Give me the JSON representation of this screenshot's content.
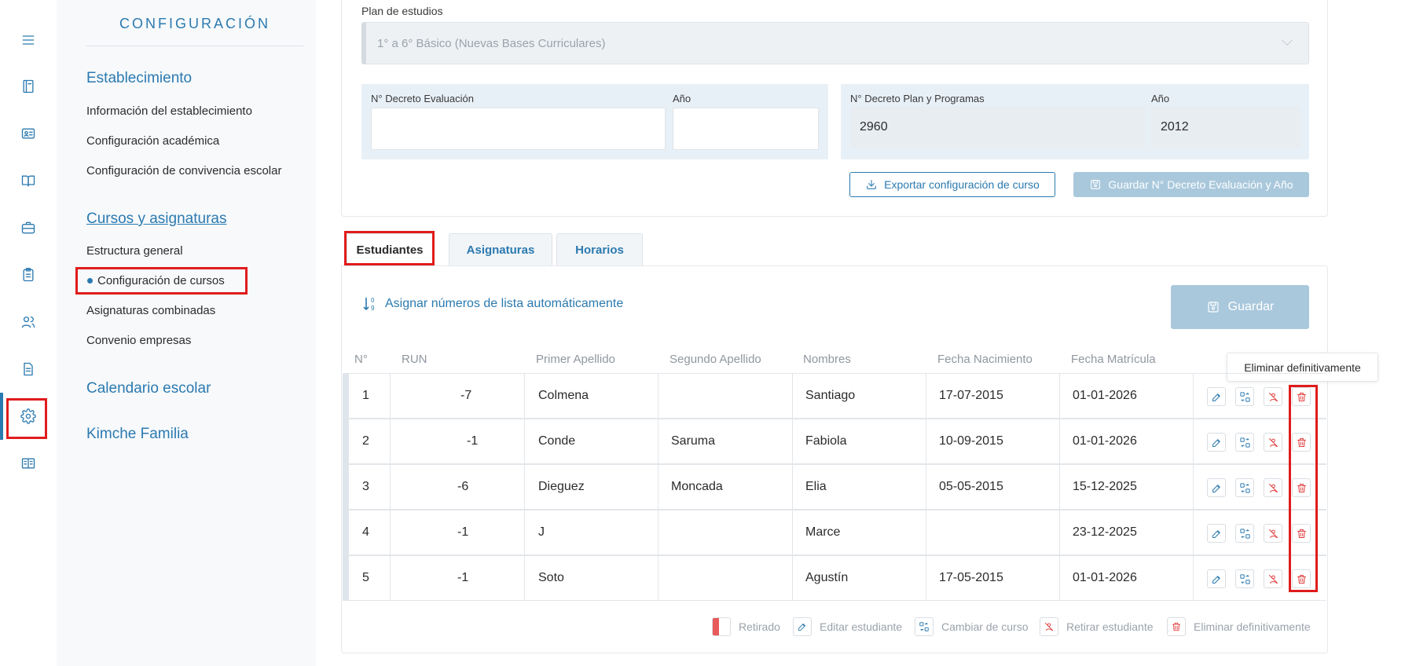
{
  "rail": {
    "icons": [
      "menu-icon",
      "book-icon",
      "id-card-icon",
      "open-book-icon",
      "briefcase-icon",
      "clipboard-icon",
      "users-icon",
      "document-icon",
      "gear-icon",
      "notebook-icon"
    ]
  },
  "config": {
    "title": "CONFIGURACIÓN",
    "sections": [
      {
        "heading": "Establecimiento",
        "items": [
          "Información del establecimiento",
          "Configuración académica",
          "Configuración de convivencia escolar"
        ]
      },
      {
        "heading": "Cursos y asignaturas",
        "items": [
          "Estructura general",
          "Configuración de cursos",
          "Asignaturas combinadas",
          "Convenio empresas"
        ]
      },
      {
        "heading": "Calendario escolar",
        "items": []
      },
      {
        "heading": "Kimche Familia",
        "items": []
      }
    ],
    "active_item": "Configuración de cursos"
  },
  "plan": {
    "label": "Plan de estudios",
    "value": "1° a 6° Básico (Nuevas Bases Curriculares)"
  },
  "decreto_eval": {
    "label": "N° Decreto Evaluación",
    "value": "",
    "year_label": "Año",
    "year_value": ""
  },
  "decreto_plan": {
    "label": "N° Decreto Plan y Programas",
    "value": "2960",
    "year_label": "Año",
    "year_value": "2012"
  },
  "buttons": {
    "export": "Exportar configuración de curso",
    "save_decree": "Guardar N° Decreto Evaluación y Año",
    "assign_numbers": "Asignar números de lista automáticamente",
    "save": "Guardar"
  },
  "tabs": [
    "Estudiantes",
    "Asignaturas",
    "Horarios"
  ],
  "table": {
    "headers": [
      "N°",
      "RUN",
      "Primer Apellido",
      "Segundo Apellido",
      "Nombres",
      "Fecha Nacimiento",
      "Fecha Matrícula"
    ],
    "rows": [
      {
        "n": "1",
        "run": "-7",
        "ap1": "Colmena",
        "ap2": "",
        "nombres": "Santiago",
        "nac": "17-07-2015",
        "mat": "01-01-2026"
      },
      {
        "n": "2",
        "run": "-1",
        "ap1": "Conde",
        "ap2": "Saruma",
        "nombres": "Fabiola",
        "nac": "10-09-2015",
        "mat": "01-01-2026"
      },
      {
        "n": "3",
        "run": "-6",
        "ap1": "Dieguez",
        "ap2": "Moncada",
        "nombres": "Elia",
        "nac": "05-05-2015",
        "mat": "15-12-2025"
      },
      {
        "n": "4",
        "run": "-1",
        "ap1": "J",
        "ap2": "",
        "nombres": "Marce",
        "nac": "",
        "mat": "23-12-2025"
      },
      {
        "n": "5",
        "run": "-1",
        "ap1": "Soto",
        "ap2": "",
        "nombres": "Agustín",
        "nac": "17-05-2015",
        "mat": "01-01-2026"
      }
    ]
  },
  "tooltip": "Eliminar definitivamente",
  "legend": {
    "retirado": "Retirado",
    "editar": "Editar estudiante",
    "cambiar": "Cambiar de curso",
    "retirar": "Retirar estudiante",
    "eliminar": "Eliminar definitivamente"
  },
  "colors": {
    "accent": "#2b7ab0",
    "highlight": "#e01c1c",
    "danger": "#e03c3c",
    "disabled_button": "#a9c8dc"
  }
}
